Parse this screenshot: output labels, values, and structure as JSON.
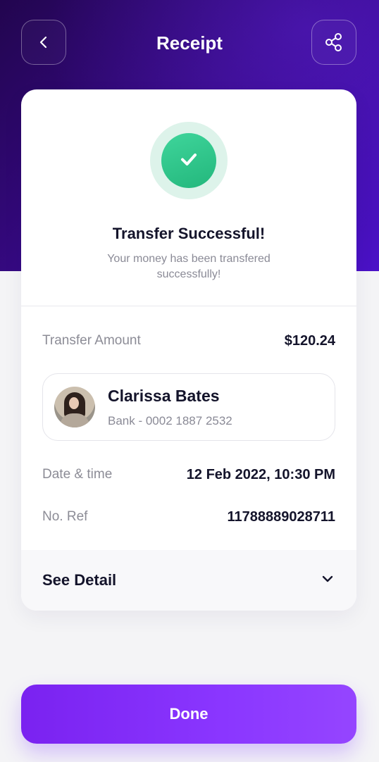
{
  "header": {
    "title": "Receipt",
    "back_icon": "chevron-left-icon",
    "share_icon": "share-icon"
  },
  "status": {
    "icon": "check-icon",
    "title": "Transfer Successful!",
    "subtitle": "Your money has been transfered successfully!"
  },
  "details": {
    "amount_label": "Transfer Amount",
    "amount_value": "$120.24",
    "recipient": {
      "name": "Clarissa Bates",
      "account": "Bank - 0002 1887 2532"
    },
    "date_label": "Date & time",
    "date_value": "12 Feb 2022, 10:30 PM",
    "ref_label": "No. Ref",
    "ref_value": "11788889028711"
  },
  "see_detail": {
    "label": "See Detail",
    "icon": "chevron-down-icon"
  },
  "done_label": "Done",
  "colors": {
    "header_gradient_start": "#22054F",
    "header_gradient_end": "#4B12C8",
    "success_green": "#23B77C",
    "button_purple": "#8A36FF",
    "text_dark": "#14142B",
    "text_muted": "#8C8C96"
  }
}
